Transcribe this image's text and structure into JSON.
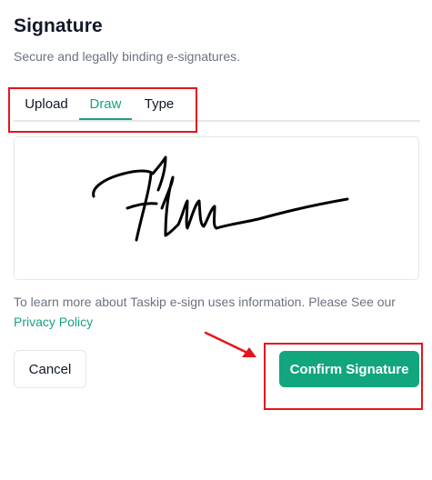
{
  "dialog": {
    "title": "Signature",
    "subtitle": "Secure and legally binding e-signatures."
  },
  "tabs": [
    {
      "label": "Upload",
      "active": false
    },
    {
      "label": "Draw",
      "active": true
    },
    {
      "label": "Type",
      "active": false
    }
  ],
  "signature_pad": {
    "content": "drawn-signature"
  },
  "info": {
    "text": "To learn more about Taskip e-sign uses information. Please See our ",
    "link_label": "Privacy Policy"
  },
  "actions": {
    "cancel_label": "Cancel",
    "confirm_label": "Confirm Signature"
  },
  "colors": {
    "accent": "#12a67e",
    "annotation": "#e3151c",
    "ink": "#000000"
  }
}
